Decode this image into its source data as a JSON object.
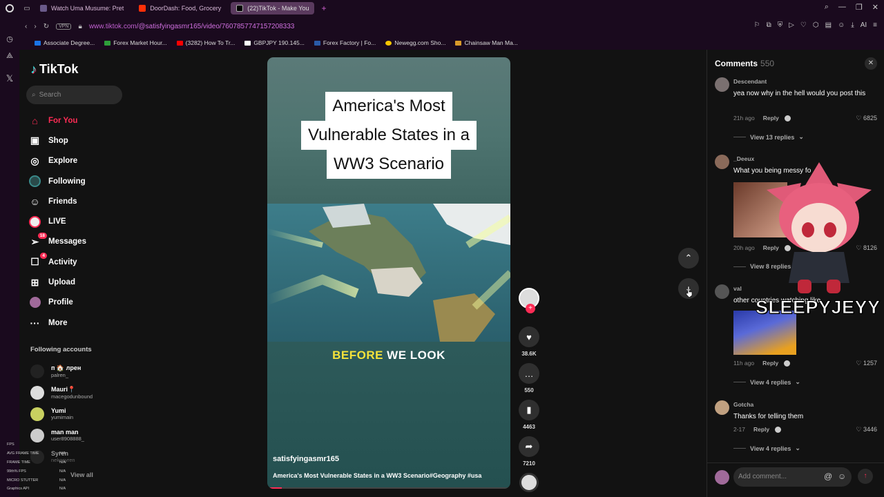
{
  "browser": {
    "tabs": [
      {
        "label": "Watch Uma Musume: Pret",
        "color": "#6a5a8a"
      },
      {
        "label": "DoorDash: Food, Grocery",
        "color": "#ff3008"
      },
      {
        "label": "(22)TikTok - Make You",
        "color": "#000000"
      }
    ],
    "url_host": "www.tiktok.com",
    "url_path": "/@satisfyingasmr165/video/7607857747157208333",
    "vpn_label": "VPN",
    "ai_label": "AI",
    "bookmarks": [
      {
        "label": "Associate Degree...",
        "color": "#1a73e8"
      },
      {
        "label": "Forex Market Hour...",
        "color": "#2e9d3a"
      },
      {
        "label": "(3282) How To Tr...",
        "color": "#ff0000"
      },
      {
        "label": "GBPJPY 190.145...",
        "color": "#ffffff"
      },
      {
        "label": "Forex Factory | Fo...",
        "color": "#2a5aa8"
      },
      {
        "label": "Newegg.com Sho...",
        "color": "#f7c600"
      },
      {
        "label": "Chainsaw Man Ma...",
        "color": "#d89a2a"
      }
    ]
  },
  "sidebar": {
    "logo": "TikTok",
    "search_placeholder": "Search",
    "nav": [
      {
        "label": "For You",
        "icon": "home-icon",
        "glyph": "⌂"
      },
      {
        "label": "Shop",
        "icon": "shop-icon",
        "glyph": "▣"
      },
      {
        "label": "Explore",
        "icon": "compass-icon",
        "glyph": "◎"
      },
      {
        "label": "Following",
        "icon": "following-icon",
        "glyph": "●"
      },
      {
        "label": "Friends",
        "icon": "friends-icon",
        "glyph": "☺"
      },
      {
        "label": "LIVE",
        "icon": "live-icon",
        "glyph": "◉"
      },
      {
        "label": "Messages",
        "icon": "messages-icon",
        "glyph": "➢",
        "badge": "18"
      },
      {
        "label": "Activity",
        "icon": "activity-icon",
        "glyph": "☐",
        "badge": "4"
      },
      {
        "label": "Upload",
        "icon": "upload-icon",
        "glyph": "⊞"
      },
      {
        "label": "Profile",
        "icon": "profile-icon",
        "glyph": "●"
      },
      {
        "label": "More",
        "icon": "more-icon",
        "glyph": "···"
      }
    ],
    "following_title": "Following accounts",
    "following": [
      {
        "name": "п 🏠 лрен",
        "handle": "palren_"
      },
      {
        "name": "Mauri📍",
        "handle": "macegodunbound"
      },
      {
        "name": "Yumi",
        "handle": "yumimain"
      },
      {
        "name": "man man",
        "handle": "user8908888_"
      },
      {
        "name": "Syren",
        "handle": "nekosyren"
      }
    ],
    "view_all": "View all"
  },
  "perf_overlay": [
    {
      "k": "FPS",
      "v": ""
    },
    {
      "k": "AVG FRAME TIME",
      "v": "N/A"
    },
    {
      "k": "FRAME TIME",
      "v": "N/A"
    },
    {
      "k": "99th% FPS",
      "v": "N/A"
    },
    {
      "k": "MICRO STUTTER",
      "v": "N/A"
    },
    {
      "k": "Graphics API",
      "v": "N/A"
    }
  ],
  "video": {
    "title_lines": [
      "America's Most",
      "Vulnerable States in a",
      "WW3 Scenario"
    ],
    "caption_yellow": "BEFORE",
    "caption_white": " WE LOOK",
    "author": "satisfyingasmr165",
    "description": "America's Most Vulnerable States in a WW3 Scenario#Geography #usa",
    "progress": 0.06
  },
  "actions": {
    "likes": "38.6K",
    "comments": "550",
    "saves": "4463",
    "shares": "7210"
  },
  "comments": {
    "title": "Comments",
    "count": "550",
    "add_placeholder": "Add comment...",
    "items": [
      {
        "user": "Descendant",
        "text": "yea now why in the hell would you post this",
        "time": "21h ago",
        "reply": "Reply",
        "likes": "6825",
        "replies": "View 13 replies"
      },
      {
        "user": "_Deeux",
        "text": "What you being messy fo",
        "time": "20h ago",
        "reply": "Reply",
        "likes": "8126",
        "replies": "View 8 replies"
      },
      {
        "user": "val",
        "text": "other countries watching like",
        "time": "11h ago",
        "reply": "Reply",
        "likes": "1257",
        "replies": "View 4 replies"
      },
      {
        "user": "Gotcha",
        "text": "Thanks for telling them",
        "time": "2-17",
        "reply": "Reply",
        "likes": "3446",
        "replies": "View 4 replies"
      }
    ]
  },
  "streamer_overlay": "SLEEPYJEYY"
}
